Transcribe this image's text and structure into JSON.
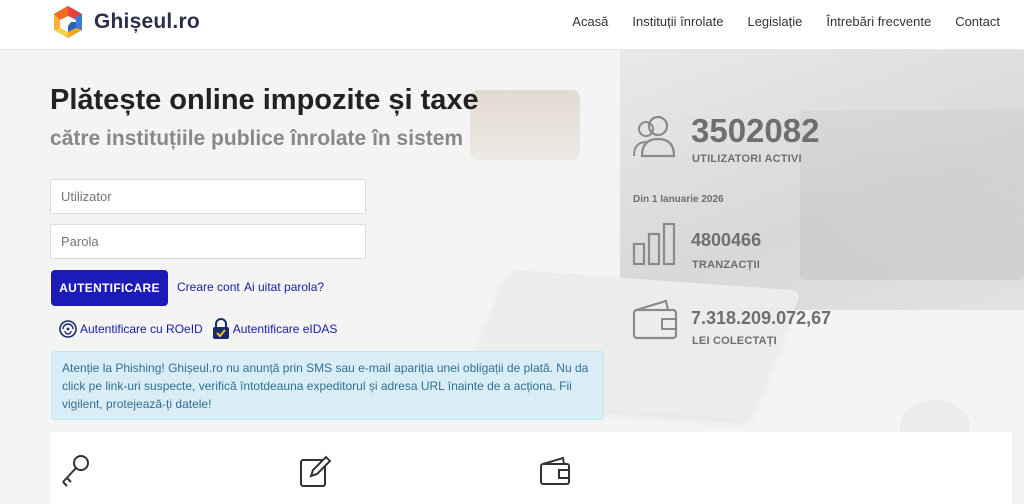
{
  "brand": {
    "name": "Ghișeul.ro"
  },
  "nav": [
    "Acasă",
    "Instituții înrolate",
    "Legislație",
    "Întrebări frecvente",
    "Contact"
  ],
  "hero": {
    "title": "Plătește online impozite și taxe",
    "subtitle": "către instituțiile publice înrolate în sistem"
  },
  "login": {
    "user_placeholder": "Utilizator",
    "pass_placeholder": "Parola",
    "button": "AUTENTIFICARE",
    "create_account": "Creare cont",
    "forgot_password": "Ai uitat parola?",
    "auth_roeid": "Autentificare cu ROeID",
    "auth_eidas": "Autentificare eIDAS"
  },
  "alert": {
    "text": "Atenție la Phishing! Ghișeul.ro nu anunță prin SMS sau e-mail apariția unei obligații de plată. Nu da click pe link-uri suspecte, verifică întotdeauna expeditorul și adresa URL înainte de a acționa. Fii vigilent, protejează-ți datele!"
  },
  "stats": {
    "users_value": "3502082",
    "users_label": "UTILIZATORI ACTIVI",
    "since": "Din 1 Ianuarie 2026",
    "transactions_value": "4800466",
    "transactions_label": "TRANZACȚII",
    "collected_value": "7.318.209.072,67",
    "collected_label": "LEI COLECTAȚI"
  },
  "icons": {
    "users": "users-icon",
    "chart": "bar-chart-icon",
    "wallet": "wallet-icon",
    "key": "key-icon",
    "edit": "edit-icon",
    "card": "wallet-icon"
  },
  "colors": {
    "primary": "#1c1bb7",
    "link": "#1a1aa6",
    "alert_bg": "#d9edf7",
    "alert_text": "#31708f",
    "stat_text": "#6f6f6f"
  }
}
